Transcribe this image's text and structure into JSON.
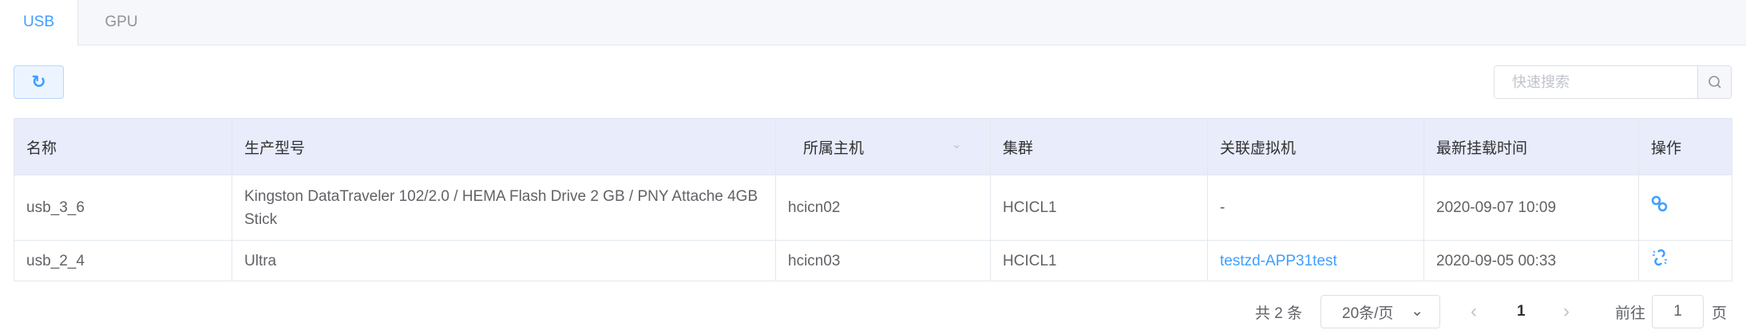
{
  "tabs": [
    {
      "label": "USB",
      "active": true
    },
    {
      "label": "GPU",
      "active": false
    }
  ],
  "toolbar": {
    "refresh_icon": "refresh-icon",
    "search_placeholder": "快速搜索",
    "search_icon": "search-icon"
  },
  "table": {
    "columns": [
      "名称",
      "生产型号",
      "所属主机",
      "集群",
      "关联虚拟机",
      "最新挂载时间",
      "操作"
    ],
    "rows": [
      {
        "name": "usb_3_6",
        "model": "Kingston DataTraveler 102/2.0 / HEMA Flash Drive 2 GB / PNY Attache 4GB Stick",
        "host": "hcicn02",
        "cluster": "HCICL1",
        "vm": "-",
        "time": "2020-09-07 10:09",
        "action_icon": "link-icon"
      },
      {
        "name": "usb_2_4",
        "model": "Ultra",
        "host": "hcicn03",
        "cluster": "HCICL1",
        "vm": "testzd-APP31test",
        "time": "2020-09-05 00:33",
        "action_icon": "unlink-icon"
      }
    ]
  },
  "pagination": {
    "total": "共 2 条",
    "page_size": "20条/页",
    "current_page": "1",
    "goto_label": "前往",
    "goto_value": "1",
    "page_suffix": "页"
  },
  "colors": {
    "accent": "#409eff",
    "header_bg": "#e8ecfb"
  }
}
